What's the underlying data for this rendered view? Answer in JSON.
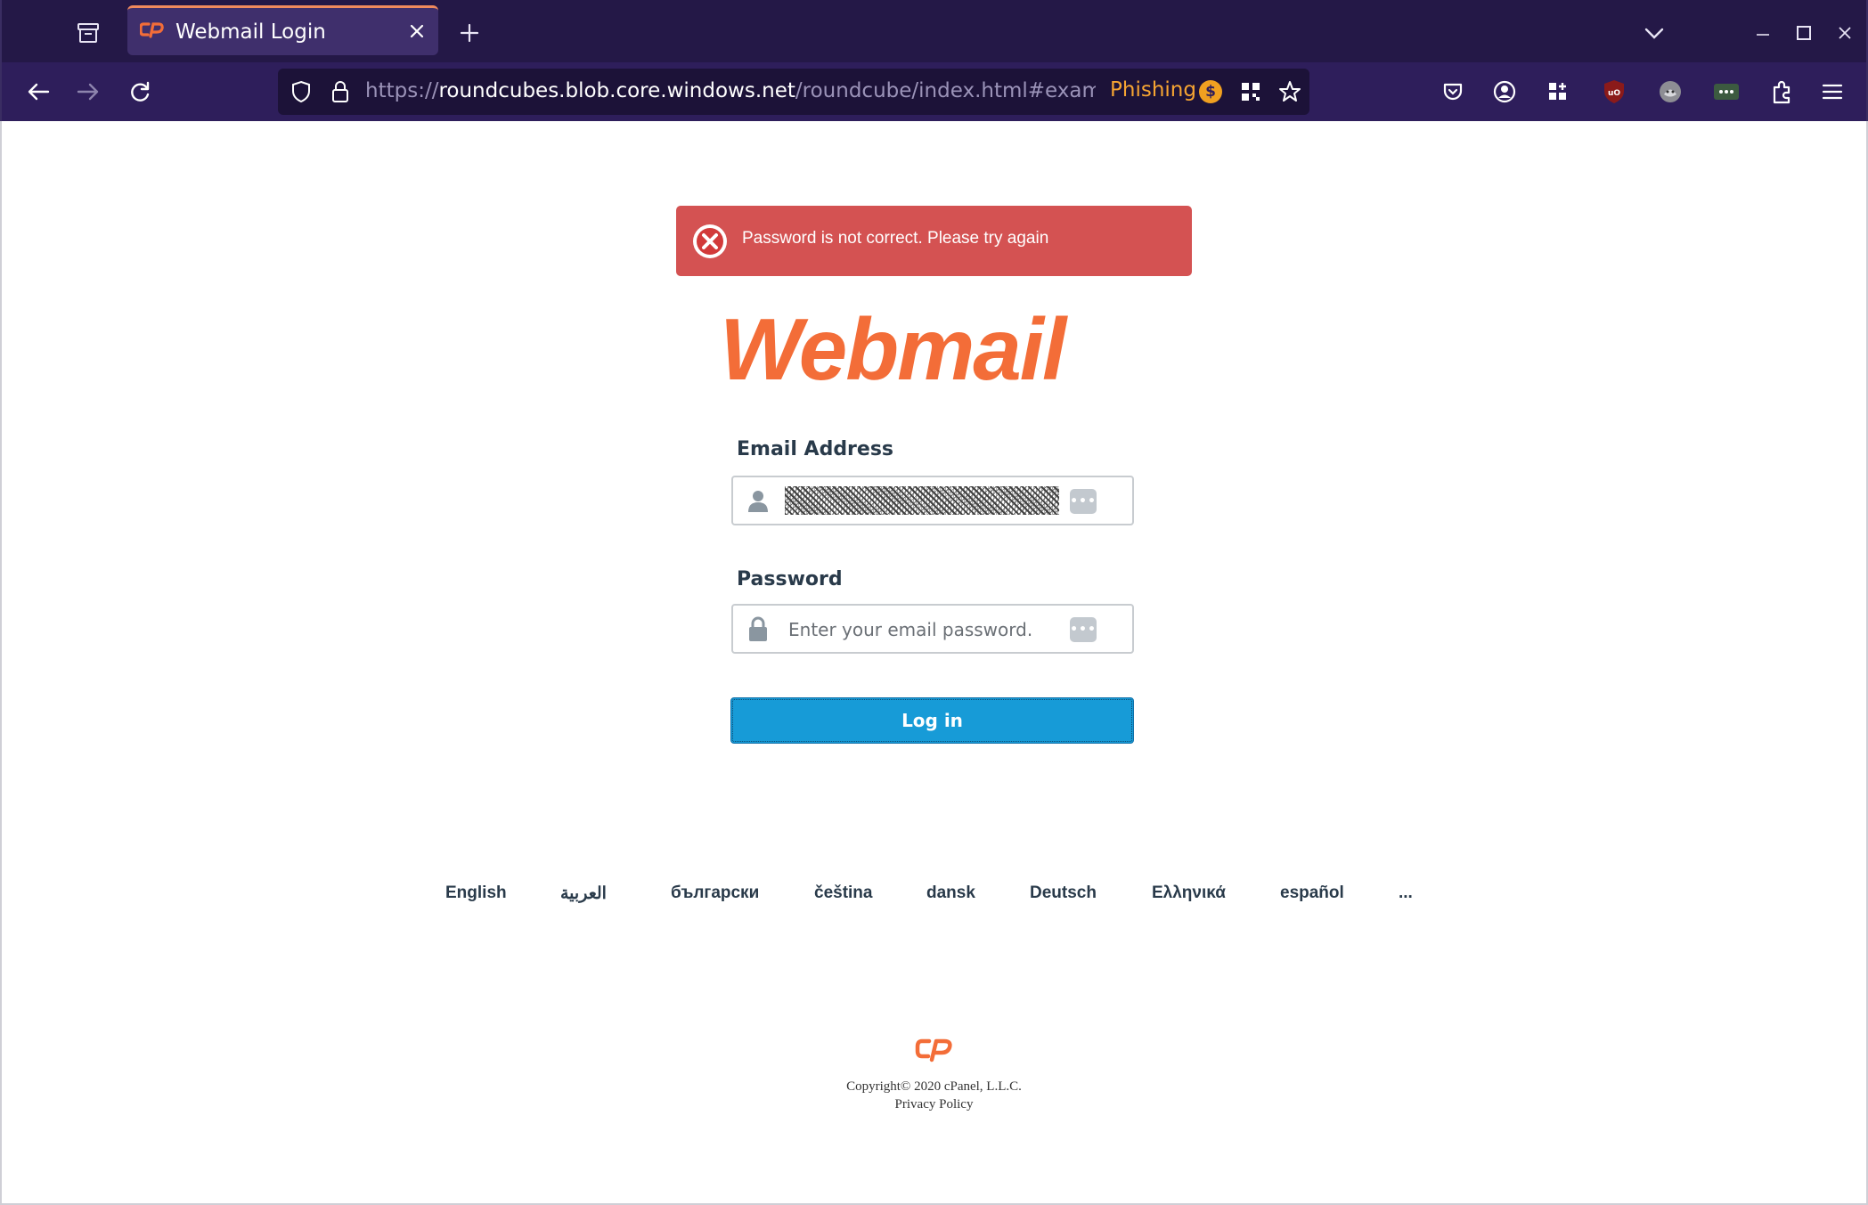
{
  "browser": {
    "tab_title": "Webmail Login",
    "url_scheme": "https://",
    "url_host": "roundcubes.blob.core.windows.net",
    "url_path": "/roundcube/index.html#examp",
    "phishing_label": "Phishing",
    "coin_symbol": "$",
    "icons": {
      "tab_manager": "collection-icon",
      "tab_favicon": "cpanel-icon",
      "new_tab": "plus-icon",
      "list_tabs": "chevron-down-icon",
      "minimize": "minimize-icon",
      "maximize": "maximize-icon",
      "close_window": "close-icon",
      "back": "back-arrow-icon",
      "forward": "forward-arrow-icon",
      "reload": "reload-icon",
      "tracking_protection": "shield-icon",
      "secure": "lock-icon",
      "qr": "qr-code-icon",
      "bookmark": "star-icon",
      "pocket": "pocket-icon",
      "account": "account-icon",
      "extensions_grid": "grid-icon",
      "ublock": "ublock-icon",
      "privacy_badger": "badger-icon",
      "bitwarden": "password-manager-icon",
      "extensions": "puzzle-icon",
      "menu": "hamburger-icon"
    },
    "colors": {
      "tabbar": "#241847",
      "toolbar": "#2e1e5b",
      "phishing": "#f7a532"
    }
  },
  "alert": {
    "message": "Password is not correct. Please try again",
    "icon": "error-x-icon",
    "color": "#d45252"
  },
  "logo": {
    "text": "Webmail",
    "color": "#f36d38"
  },
  "form": {
    "email_label": "Email Address",
    "email_icon": "user-icon",
    "password_label": "Password",
    "password_placeholder": "Enter your email password.",
    "password_icon": "lock-icon",
    "dots_label": "•••",
    "login_label": "Log in",
    "button_color": "#179bd7"
  },
  "languages": [
    "English",
    "العربية",
    "български",
    "čeština",
    "dansk",
    "Deutsch",
    "Ελληνικά",
    "español",
    "..."
  ],
  "footer": {
    "copyright": "Copyright© 2020 cPanel, L.L.C.",
    "privacy": "Privacy Policy",
    "logo_icon": "cpanel-icon"
  }
}
